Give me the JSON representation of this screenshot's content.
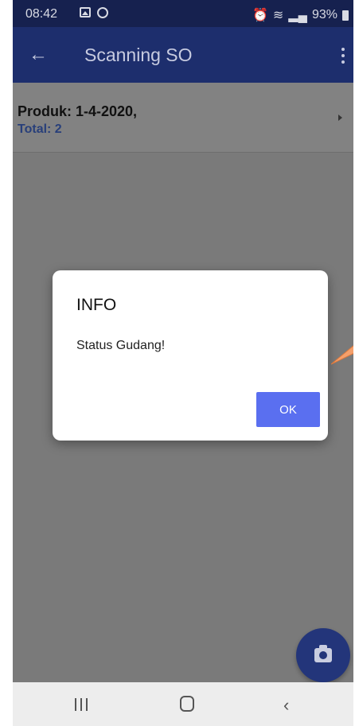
{
  "status_bar": {
    "time": "08:42",
    "battery": "93%",
    "icons": [
      "gallery-icon",
      "whatsapp-icon",
      "alarm-icon",
      "wifi-icon",
      "signal-icon",
      "battery-icon"
    ]
  },
  "app_bar": {
    "title": "Scanning SO",
    "back_icon": "arrow-left-icon",
    "menu_icon": "more-vert-icon",
    "color": "#1d2e6d"
  },
  "list": {
    "items": [
      {
        "title": "Produk: 1-4-2020,",
        "total": "Total: 2"
      }
    ]
  },
  "dialog": {
    "title": "INFO",
    "message": "Status Gudang!",
    "ok_label": "OK",
    "ok_color": "#5a6ff0"
  },
  "fab": {
    "icon": "camera-icon",
    "color": "#23357a"
  },
  "nav_bar": {
    "icons": [
      "recent-apps-icon",
      "home-icon",
      "back-icon"
    ]
  }
}
